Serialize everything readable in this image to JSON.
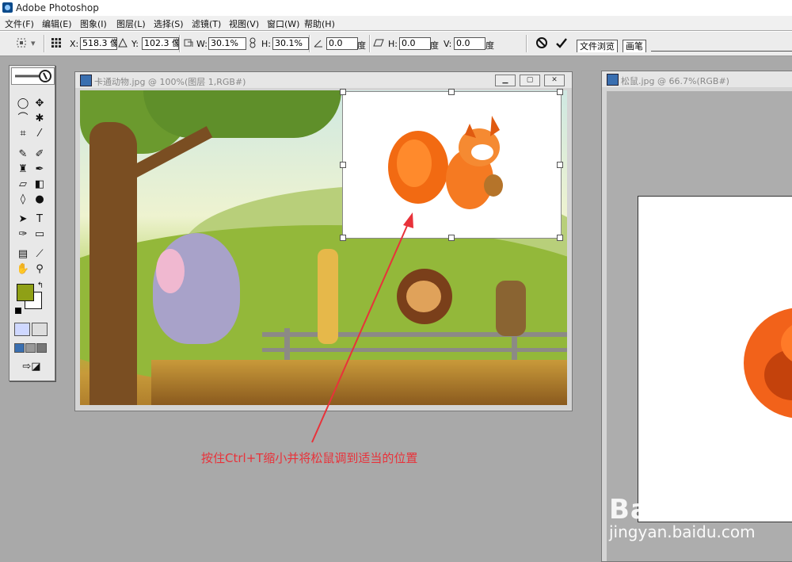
{
  "app": {
    "title": "Adobe Photoshop"
  },
  "menu": [
    "文件(F)",
    "编辑(E)",
    "图象(I)",
    "图层(L)",
    "选择(S)",
    "滤镜(T)",
    "视图(V)",
    "窗口(W)",
    "帮助(H)"
  ],
  "options": {
    "x_label": "X:",
    "x_value": "518.3 像",
    "y_label": "Y:",
    "y_value": "102.3 像",
    "w_label": "W:",
    "w_value": "30.1%",
    "h_label": "H:",
    "h_value": "30.1%",
    "angle_value": "0.0",
    "angle_unit": "度",
    "skew_h_label": "H:",
    "skew_h_value": "0.0",
    "skew_h_unit": "度",
    "skew_v_label": "V:",
    "skew_v_value": "0.0",
    "skew_v_unit": "度"
  },
  "palette_well": {
    "tabs": [
      "文件浏览",
      "画笔"
    ]
  },
  "toolbox": {
    "foreground_color": "#8fa016",
    "background_color": "#ffffff"
  },
  "doc1": {
    "title": "卡通动物.jpg @ 100%(图层 1,RGB#)"
  },
  "doc2": {
    "title": "松鼠.jpg @ 66.7%(RGB#)"
  },
  "annotation": {
    "text": "按住Ctrl+T缩小并将松鼠调到适当的位置",
    "color": "#e8323a"
  },
  "watermark": {
    "brand": "Baidu经验",
    "url": "jingyan.baidu.com"
  }
}
